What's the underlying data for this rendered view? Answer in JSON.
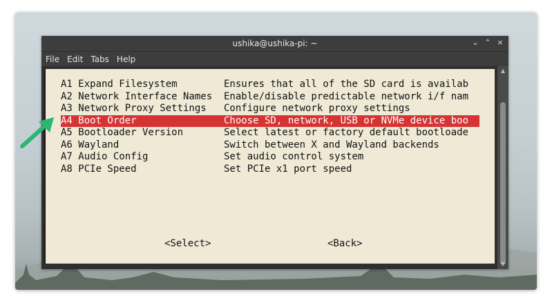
{
  "window": {
    "title": "ushika@ushika-pi: ~",
    "controls": [
      "⌄",
      "⌃",
      "×"
    ]
  },
  "menubar": [
    "File",
    "Edit",
    "Tabs",
    "Help"
  ],
  "menu_items": [
    {
      "key": "A1 Expand Filesystem",
      "desc": "Ensures that all of the SD card is availab",
      "selected": false
    },
    {
      "key": "A2 Network Interface Names",
      "desc": "Enable/disable predictable network i/f nam",
      "selected": false
    },
    {
      "key": "A3 Network Proxy Settings",
      "desc": "Configure network proxy settings",
      "selected": false
    },
    {
      "key": "A4 Boot Order",
      "desc": "Choose SD, network, USB or NVMe device boo",
      "selected": true
    },
    {
      "key": "A5 Bootloader Version",
      "desc": "Select latest or factory default bootloade",
      "selected": false
    },
    {
      "key": "A6 Wayland",
      "desc": "Switch between X and Wayland backends",
      "selected": false
    },
    {
      "key": "A7 Audio Config",
      "desc": "Set audio control system",
      "selected": false
    },
    {
      "key": "A8 PCIe Speed",
      "desc": "Set PCIe x1 port speed",
      "selected": false
    }
  ],
  "buttons": {
    "select": "<Select>",
    "back": "<Back>"
  },
  "colors": {
    "selection": "#d63434",
    "dialog_bg": "#efe9d6",
    "titlebar": "#3d3d3d",
    "annotation_arrow": "#2bb673"
  },
  "icons": {
    "annotation": "arrow-pointer-icon"
  }
}
